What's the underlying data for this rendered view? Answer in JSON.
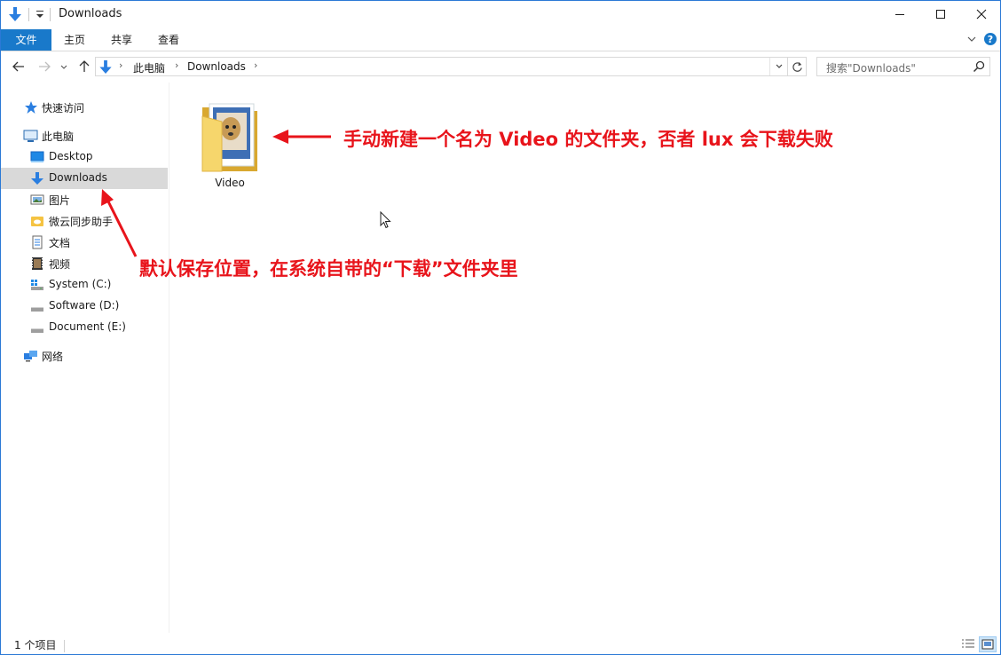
{
  "window": {
    "title": "Downloads",
    "accent": "#1979ca"
  },
  "ribbon": {
    "tabs": [
      {
        "label": "文件"
      },
      {
        "label": "主页"
      },
      {
        "label": "共享"
      },
      {
        "label": "查看"
      }
    ]
  },
  "address": {
    "crumbs": [
      "此电脑",
      "Downloads"
    ],
    "search_placeholder": "搜索\"Downloads\""
  },
  "nav": {
    "items": [
      {
        "label": "快速访问",
        "icon": "star-icon"
      },
      {
        "label": "此电脑",
        "icon": "computer-icon"
      },
      {
        "label": "Desktop",
        "icon": "desktop-icon"
      },
      {
        "label": "Downloads",
        "icon": "download-arrow-icon",
        "selected": true
      },
      {
        "label": "图片",
        "icon": "pictures-icon"
      },
      {
        "label": "微云同步助手",
        "icon": "cloud-folder-icon"
      },
      {
        "label": "文档",
        "icon": "document-icon"
      },
      {
        "label": "视频",
        "icon": "video-icon"
      },
      {
        "label": "System (C:)",
        "icon": "system-drive-icon"
      },
      {
        "label": "Software (D:)",
        "icon": "drive-icon"
      },
      {
        "label": "Document (E:)",
        "icon": "drive-icon"
      },
      {
        "label": "网络",
        "icon": "network-icon"
      }
    ]
  },
  "content": {
    "files": [
      {
        "name": "Video",
        "icon": "folder-icon"
      }
    ]
  },
  "annotations": {
    "top": "手动新建一个名为 Video 的文件夹，否者 lux 会下载失败",
    "bottom": "默认保存位置，在系统自带的“下载”文件夹里",
    "color": "#e8141b"
  },
  "status": {
    "count": "1 个项目"
  }
}
